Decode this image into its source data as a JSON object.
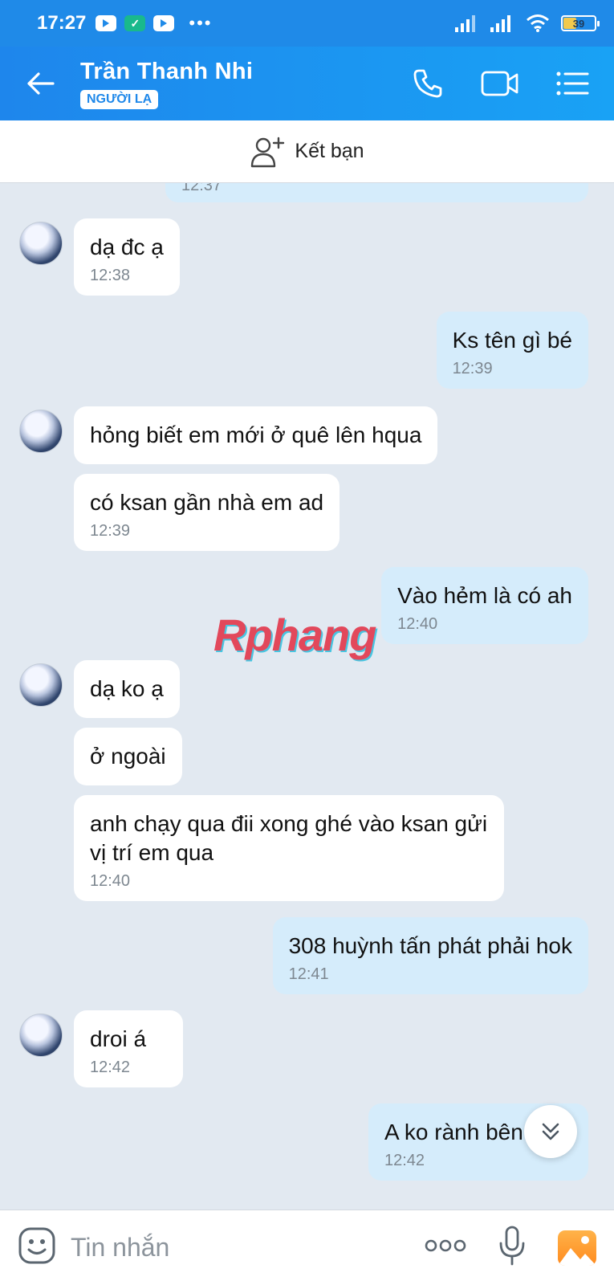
{
  "status_bar": {
    "time": "17:27",
    "battery": "39",
    "battery_level": 0.39,
    "more": "•••"
  },
  "header": {
    "contact_name": "Trần Thanh Nhi",
    "badge": "NGƯỜI LẠ"
  },
  "friend_bar": {
    "label": "Kết bạn"
  },
  "messages": [
    {
      "side": "out",
      "text": "",
      "time": "12:37"
    },
    {
      "side": "in",
      "text": "dạ đc ạ",
      "time": "12:38"
    },
    {
      "side": "out",
      "text": "Ks tên gì bé",
      "time": "12:39"
    },
    {
      "side": "in",
      "text": "hỏng biết em mới ở quê lên hqua",
      "time": ""
    },
    {
      "side": "in",
      "text": "có ksan gần nhà em ad",
      "time": "12:39"
    },
    {
      "side": "out",
      "text": "Vào hẻm là có ah",
      "time": "12:40"
    },
    {
      "side": "in",
      "text": "dạ ko ạ",
      "time": ""
    },
    {
      "side": "in",
      "text": "ở ngoài",
      "time": ""
    },
    {
      "side": "in",
      "text": "anh chạy qua đii xong ghé vào ksan gửi vị trí em qua",
      "time": "12:40"
    },
    {
      "side": "out",
      "text": "308 huỳnh tấn phát phải hok",
      "time": "12:41"
    },
    {
      "side": "in",
      "text": "droi á",
      "time": "12:42"
    },
    {
      "side": "out",
      "text": "A ko rành bên",
      "time": "12:42"
    }
  ],
  "watermark": "Rphang",
  "composer": {
    "placeholder": "Tin nhắn",
    "more": "ooo"
  },
  "colors": {
    "header": "#1e86ec",
    "bubble_out": "#d5ecfb",
    "bubble_in": "#ffffff",
    "background": "#e2e9f1"
  }
}
